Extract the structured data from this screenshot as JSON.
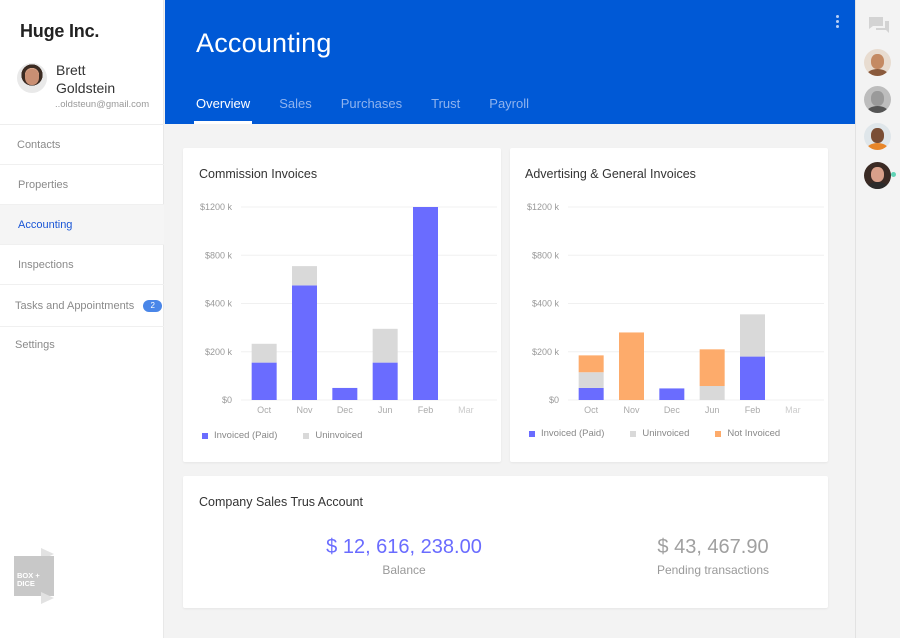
{
  "sidebar": {
    "company": "Huge Inc.",
    "user": {
      "name": "Brett Goldstein",
      "email": "..oldsteun@gmail.com",
      "avatar": "user-avatar"
    },
    "items": [
      {
        "label": "Contacts",
        "active": false
      },
      {
        "label": "Properties",
        "active": false
      },
      {
        "label": "Accounting",
        "active": true
      },
      {
        "label": "Inspections",
        "active": false
      },
      {
        "label": "Tasks and Appointments",
        "active": false,
        "badge": "2"
      },
      {
        "label": "Settings",
        "active": false
      }
    ],
    "logo": {
      "line1": "BOX +",
      "line2": "DICE"
    }
  },
  "header": {
    "title": "Accounting",
    "more_icon": "more-vertical-icon",
    "tabs": [
      {
        "label": "Overview",
        "active": true
      },
      {
        "label": "Sales",
        "active": false
      },
      {
        "label": "Purchases",
        "active": false
      },
      {
        "label": "Trust",
        "active": false
      },
      {
        "label": "Payroll",
        "active": false
      }
    ]
  },
  "right_panel": {
    "chat_icon": "chat-icon",
    "avatars": [
      {
        "name": "contact-1",
        "online": false
      },
      {
        "name": "contact-2",
        "online": false
      },
      {
        "name": "contact-3",
        "online": false
      },
      {
        "name": "contact-4",
        "online": true
      }
    ]
  },
  "colors": {
    "accent": "#0059d6",
    "invoiced": "#6a6cff",
    "uninvoiced": "#d9d9d9",
    "not_invoiced": "#fdab6b",
    "badge": "#4a86e8",
    "online": "#5fd3b5"
  },
  "chart_data": [
    {
      "type": "bar",
      "stacked": true,
      "title": "Commission Invoices",
      "categories": [
        "Oct",
        "Nov",
        "Dec",
        "Jun",
        "Feb",
        "Mar"
      ],
      "y_ticks": [
        0,
        200,
        400,
        800,
        1200
      ],
      "y_tick_labels": [
        "$0",
        "$200 k",
        "$400 k",
        "$800 k",
        "$1200 k"
      ],
      "y_unit": "k$",
      "xlabel": "",
      "ylabel": "",
      "grid": true,
      "legend": "bottom-left",
      "series": [
        {
          "name": "Invoiced (Paid)",
          "color": "#6a6cff",
          "values": [
            155,
            550,
            50,
            155,
            1200,
            0
          ]
        },
        {
          "name": "Uninvoiced",
          "color": "#d9d9d9",
          "values": [
            78,
            160,
            0,
            140,
            0,
            0
          ]
        }
      ]
    },
    {
      "type": "bar",
      "stacked": true,
      "title": "Advertising & General Invoices",
      "categories": [
        "Oct",
        "Nov",
        "Dec",
        "Jun",
        "Feb",
        "Mar"
      ],
      "y_ticks": [
        0,
        200,
        400,
        800,
        1200
      ],
      "y_tick_labels": [
        "$0",
        "$200 k",
        "$400 k",
        "$800 k",
        "$1200 k"
      ],
      "y_unit": "k$",
      "xlabel": "",
      "ylabel": "",
      "grid": true,
      "legend": "bottom-left",
      "series": [
        {
          "name": "Invoiced (Paid)",
          "color": "#6a6cff",
          "values": [
            50,
            0,
            48,
            0,
            180,
            0
          ]
        },
        {
          "name": "Uninvoiced",
          "color": "#d9d9d9",
          "values": [
            65,
            0,
            0,
            58,
            175,
            0
          ]
        },
        {
          "name": "Not Invoiced",
          "color": "#fdab6b",
          "values": [
            70,
            280,
            0,
            152,
            0,
            0
          ]
        }
      ]
    }
  ],
  "trust": {
    "title": "Company Sales Trus Account",
    "balance": {
      "value": "$ 12, 616, 238.00",
      "label": "Balance",
      "color": "#6a6cff"
    },
    "pending": {
      "value": "$ 43, 467.90",
      "label": "Pending transactions",
      "color": "#a0a0a0"
    }
  }
}
